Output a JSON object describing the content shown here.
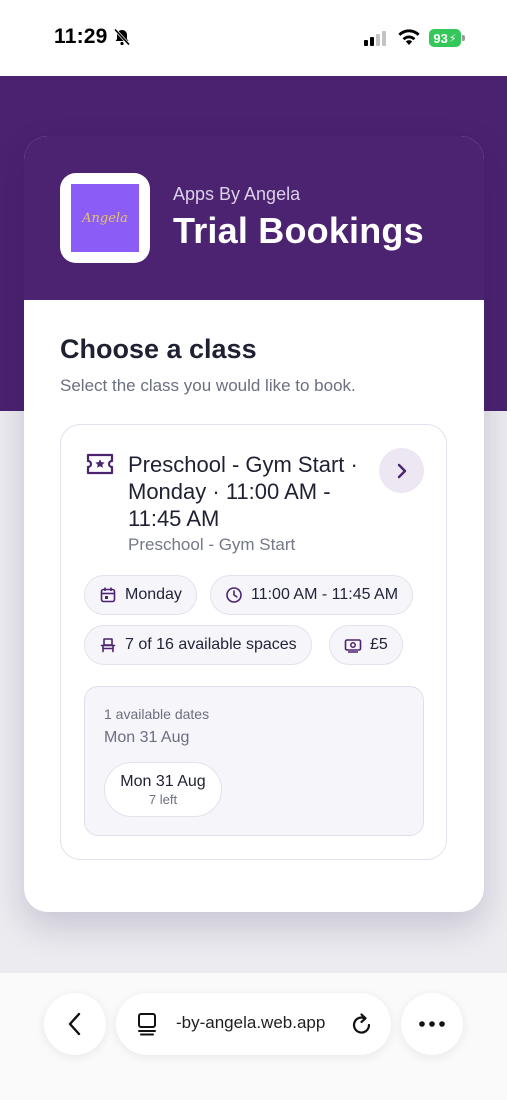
{
  "status_bar": {
    "time": "11:29",
    "battery": "93"
  },
  "header": {
    "brand": "Apps By Angela",
    "title": "Trial Bookings",
    "logo_text": "Angela"
  },
  "section": {
    "title": "Choose a class",
    "subtitle": "Select the class you would like to book."
  },
  "class_card": {
    "title": "Preschool - Gym Start · Monday · 11:00 AM - 11:45 AM",
    "subtitle": "Preschool - Gym Start",
    "chips": {
      "day": "Monday",
      "time": "11:00 AM - 11:45 AM",
      "spaces": "7 of 16 available spaces",
      "price": "£5"
    },
    "dates": {
      "count_text": "1 available dates",
      "summary": "Mon 31 Aug",
      "options": [
        {
          "date": "Mon 31 Aug",
          "left": "7 left"
        }
      ]
    }
  },
  "browser": {
    "url": "-by-angela.web.app"
  },
  "colors": {
    "brand_purple": "#4b2370",
    "accent_purple": "#8b5cf6",
    "battery_green": "#34c759"
  }
}
